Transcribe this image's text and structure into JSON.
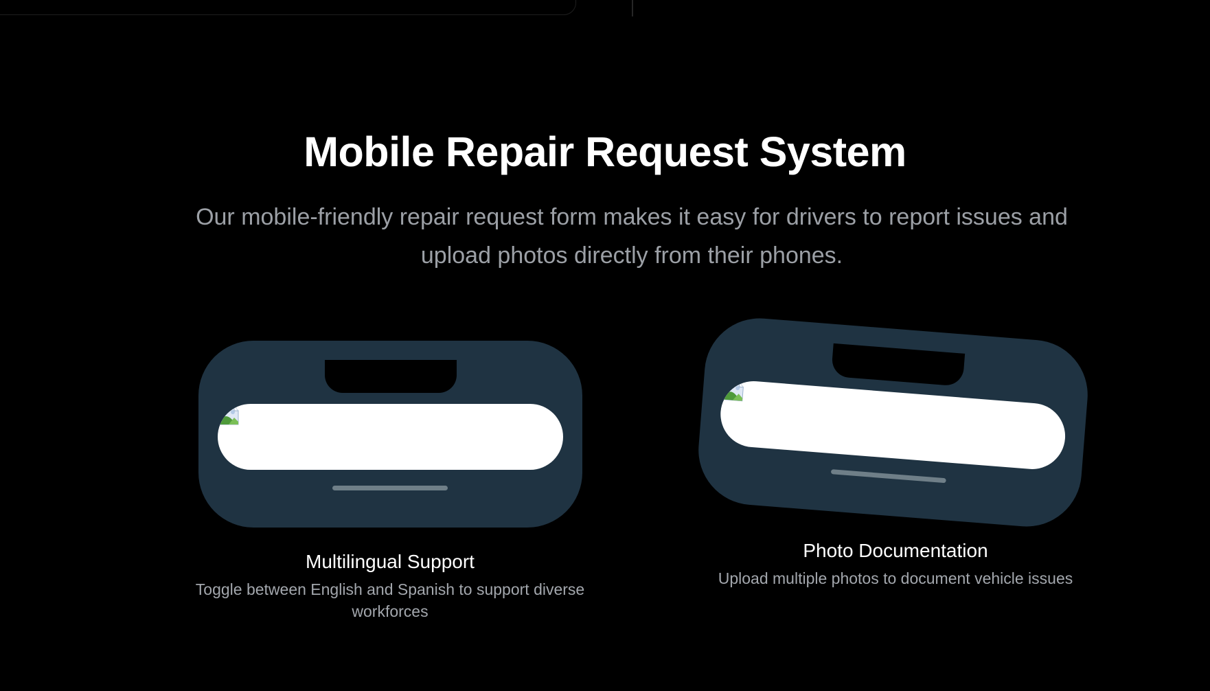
{
  "section": {
    "title": "Mobile Repair Request System",
    "subtitle": "Our mobile-friendly repair request form makes it easy for drivers to report issues and upload photos directly from their phones."
  },
  "features": [
    {
      "title": "Multilingual Support",
      "description": "Toggle between English and Spanish to support diverse workforces",
      "icon": "broken-image-icon"
    },
    {
      "title": "Photo Documentation",
      "description": "Upload multiple photos to document vehicle issues",
      "icon": "broken-image-icon"
    }
  ],
  "colors": {
    "background": "#000000",
    "phone_frame": "#1f3342",
    "screen": "#ffffff",
    "subtitle_text": "#9ca0a6",
    "home_indicator": "#6f7f88"
  }
}
